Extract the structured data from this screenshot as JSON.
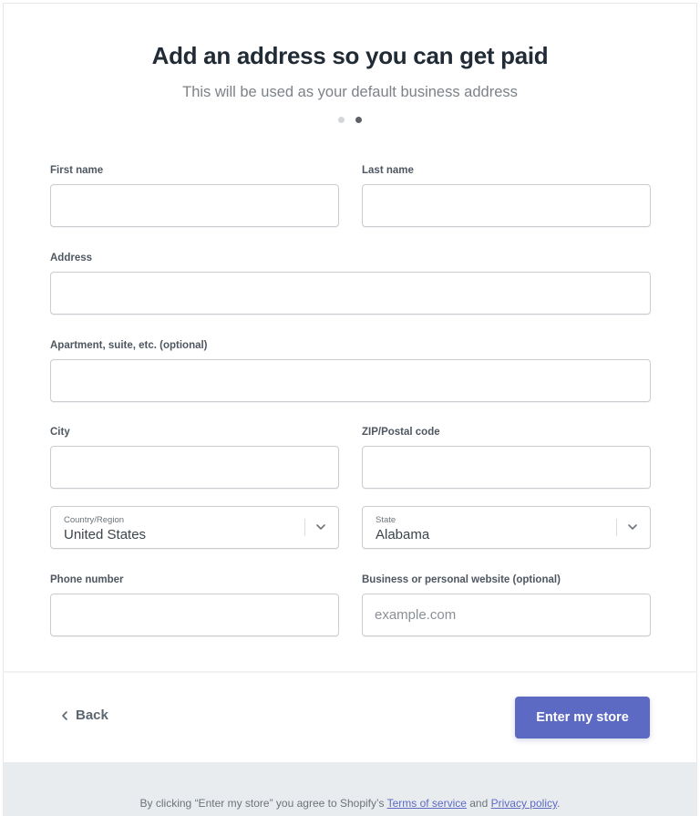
{
  "header": {
    "title": "Add an address so you can get paid",
    "subtitle": "This will be used as your default business address",
    "steps": {
      "total": 2,
      "current": 2
    }
  },
  "form": {
    "first_name": {
      "label": "First name",
      "value": "",
      "placeholder": ""
    },
    "last_name": {
      "label": "Last name",
      "value": "",
      "placeholder": ""
    },
    "address": {
      "label": "Address",
      "value": "",
      "placeholder": ""
    },
    "apartment": {
      "label": "Apartment, suite, etc. (optional)",
      "value": "",
      "placeholder": ""
    },
    "city": {
      "label": "City",
      "value": "",
      "placeholder": ""
    },
    "zip": {
      "label": "ZIP/Postal code",
      "value": "",
      "placeholder": ""
    },
    "country": {
      "label": "Country/Region",
      "value": "United States"
    },
    "state": {
      "label": "State",
      "value": "Alabama"
    },
    "phone": {
      "label": "Phone number",
      "value": "",
      "placeholder": ""
    },
    "website": {
      "label": "Business or personal website (optional)",
      "value": "",
      "placeholder": "example.com"
    }
  },
  "footer": {
    "back_label": "Back",
    "submit_label": "Enter my store",
    "legal_prefix": "By clicking “Enter my store” you agree to Shopify’s ",
    "terms_label": "Terms of service",
    "legal_and": " and ",
    "privacy_label": "Privacy policy",
    "legal_suffix": "."
  },
  "colors": {
    "accent": "#5c6ac4",
    "legal_bar": "#e9ecef"
  }
}
